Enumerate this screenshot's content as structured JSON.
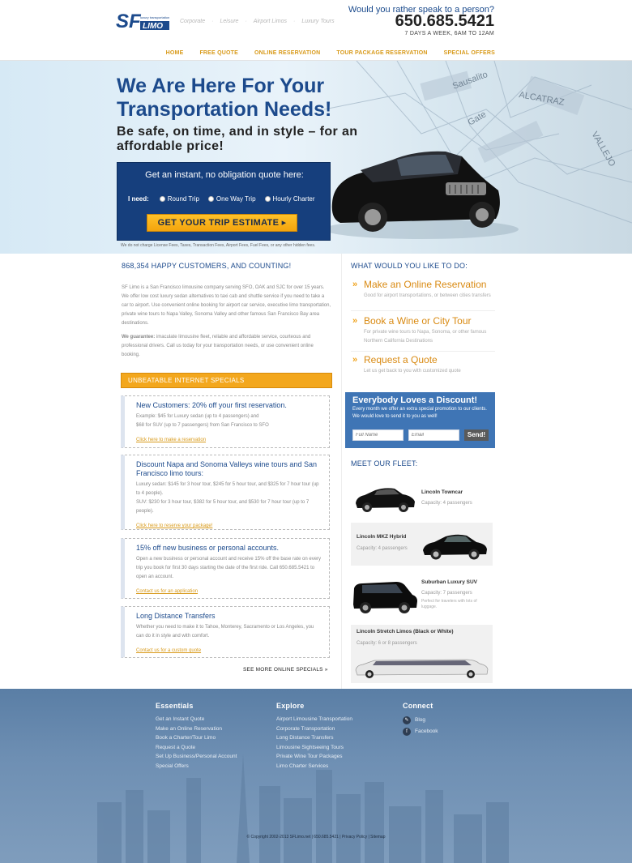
{
  "header": {
    "tagline": [
      "Corporate",
      "Leisure",
      "Airport Limos",
      "Luxury Tours"
    ],
    "phone_ask": "Would you rather speak to a person?",
    "phone": "650.685.5421",
    "hours": "7 DAYS A WEEK, 6AM TO 12AM",
    "nav": [
      "HOME",
      "FREE QUOTE",
      "ONLINE RESERVATION",
      "TOUR PACKAGE RESERVATION",
      "SPECIAL OFFERS"
    ]
  },
  "hero": {
    "title": "We Are Here For Your Transportation Needs!",
    "subtitle": "Be safe, on time, and in style – for an affordable price!",
    "quote_title": "Get an instant, no obligation quote here:",
    "need_label": "I need:",
    "options": [
      "Round Trip",
      "One Way Trip",
      "Hourly Charter"
    ],
    "button": "GET YOUR TRIP ESTIMATE ▸",
    "disclaimer": "We do not charge License Fees, Taxes, Transaction Fees, Airport Fees, Fuel Fees, or any other hidden fees."
  },
  "intro": {
    "heading": "868,354 HAPPY CUSTOMERS, AND COUNTING!",
    "p1": "SF Limo is a San Francisco limousine company serving SFO, OAK and SJC for over 15 years. We offer low cost luxury sedan alternatives to taxi cab and shuttle service if you need to take a car to airport. Use convenient online booking for airport car service, executive limo transportation, private wine tours to Napa Valley, Sonoma Valley and other famous San Francisco Bay area destinations.",
    "p2_label": "We guarantee:",
    "p2": " imaculate limousine fleet, reliable and affordable service, courteous and professional drivers. Call us today for your transportation needs, or use convenient online booking."
  },
  "specials": {
    "bar": "UNBEATABLE INTERNET SPECIALS",
    "items": [
      {
        "title": "New Customers: 20% off your first reservation.",
        "lines": [
          "Example: $45 for Luxury sedan (up to 4 passengers) and",
          "$68 for SUV (up to 7 passengers) from San Francisco to SFO"
        ],
        "cta": "Click here to make a reservation"
      },
      {
        "title": "Discount Napa and Sonoma Valleys wine tours and San Francisco limo tours:",
        "lines": [
          "Luxury sedan: $145 for 3 hour tour, $245 for 5 hour tour, and $325 for 7 hour tour (up to 4 people).",
          "SUV: $230 for 3 hour tour, $382 for 5 hour tour, and $530 for 7 hour tour (up to 7 people)."
        ],
        "cta": "Click here to reserve your package!"
      },
      {
        "title": "15% off new business or personal accounts.",
        "lines": [
          "Open a new business or personal account and receive 15% off the base rate on every trip you book for first 30 days starting the date of the first ride. Call 650.685.5421 to open an account."
        ],
        "cta": "Contact us for an application"
      },
      {
        "title": "Long Distance Transfers",
        "lines": [
          "Whether you need to make it to Tahoe, Monterey, Sacramento or Los Angeles, you can do it in style and with comfort."
        ],
        "cta": "Contact us for a custom quote"
      }
    ],
    "see_more": "SEE MORE ONLINE SPECIALS"
  },
  "actions": {
    "heading": "WHAT WOULD YOU LIKE TO DO:",
    "items": [
      {
        "title": "Make an Online Reservation",
        "desc": "Good for airport transportations, or between cities transfers"
      },
      {
        "title": "Book a Wine or City Tour",
        "desc": "For private wine tours to Napa, Sonoma, or other famous Northern California Destinations"
      },
      {
        "title": "Request a Quote",
        "desc": "Let us get back to you with customized quote"
      }
    ]
  },
  "discount": {
    "title": "Everybody Loves a Discount!",
    "text": "Every month we offer an extra special promotion to our clients.  We would love to send it to you as well!",
    "name_placeholder": "Full Name",
    "email_placeholder": "Email",
    "send": "Send!"
  },
  "fleet": {
    "heading": "MEET OUR FLEET:",
    "items": [
      {
        "name": "Lincoln Towncar",
        "capacity": "Capacity: 4 passengers"
      },
      {
        "name": "Lincoln MKZ Hybrid",
        "capacity": "Capacity: 4 passengers"
      },
      {
        "name": "Suburban Luxury SUV",
        "capacity": "Capacity: 7 passengers",
        "note": "Perfect for travelers with lots of luggage."
      },
      {
        "name": "Lincoln Stretch Limos (Black or White)",
        "capacity": "Capacity: 6 or 8 passengers"
      }
    ]
  },
  "footer": {
    "essentials": {
      "title": "Essentials",
      "links": [
        "Get an Instant Quote",
        "Make an Online Reservation",
        "Book a Charter/Tour Limo",
        "Request a Quote",
        "Set Up Business/Personal Account",
        "Special Offers"
      ]
    },
    "explore": {
      "title": "Explore",
      "links": [
        "Airport Limousine Transportation",
        "Corporate Transportation",
        "Long Distance Transfers",
        "Limousine Sightseeing Tours",
        "Private Wine Tour Packages",
        "Limo Charter Services"
      ]
    },
    "connect": {
      "title": "Connect",
      "links": [
        "Blog",
        "Facebook"
      ]
    },
    "copyright": "© Copyright 2002-2013 SFLimo.net | 650.685.5421 | Privacy Policy | Sitemap"
  },
  "colors": {
    "brand_blue": "#1c4a8c",
    "accent_orange": "#f3a71d",
    "link_gold": "#d89a1a"
  }
}
